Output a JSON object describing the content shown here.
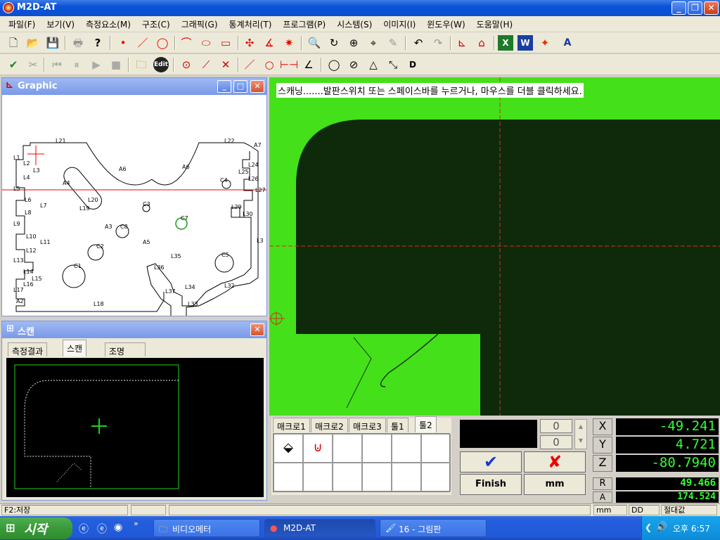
{
  "window": {
    "title": "M2D-AT",
    "min_label": "_",
    "max_label": "❐",
    "close_label": "✕"
  },
  "menu": [
    "파일(F)",
    "보기(V)",
    "측정요소(M)",
    "구조(C)",
    "그래픽(G)",
    "통계처리(T)",
    "프로그램(P)",
    "시스템(S)",
    "이미지(I)",
    "윈도우(W)",
    "도움말(H)"
  ],
  "toolbar": {
    "edit_label": "Edit",
    "dim_label": "D",
    "text_label": "A",
    "excel_label": "X",
    "word_label": "W"
  },
  "graphic_panel": {
    "title": "Graphic",
    "labels": [
      "L21",
      "L22",
      "A7",
      "L1",
      "L2",
      "L3",
      "A6",
      "A6",
      "L24",
      "L25",
      "L26",
      "L4",
      "L5",
      "A4",
      "C4",
      "L27",
      "L6",
      "L7",
      "L20",
      "C3",
      "L29",
      "L8",
      "L19",
      "C7",
      "L30",
      "L9",
      "A3",
      "C8",
      "L10",
      "L11",
      "C2",
      "A5",
      "L3",
      "L12",
      "L35",
      "L13",
      "C1",
      "L36",
      "C5",
      "L14",
      "L15",
      "L16",
      "L17",
      "L37",
      "L34",
      "L32",
      "A2",
      "L18",
      "L33"
    ]
  },
  "scan_panel": {
    "title": "스캔",
    "tabs": [
      "측정결과",
      "스캔",
      "조명"
    ]
  },
  "camera": {
    "instruction": "스캐닝.......발판스위치 또는 스페이스바를 누르거나, 마우스를 더블 클릭하세요."
  },
  "macro_tabs": [
    "매크로1",
    "매크로2",
    "매크로3",
    "툴1",
    "툴2"
  ],
  "counters": {
    "top": "0",
    "bottom": "0"
  },
  "actions": {
    "finish_label": "Finish",
    "unit_label": "mm"
  },
  "readouts": [
    {
      "axis": "X",
      "value": "-49.241"
    },
    {
      "axis": "Y",
      "value": "4.721"
    },
    {
      "axis": "Z",
      "value": "-80.7940"
    },
    {
      "axis": "R",
      "value": "49.466"
    },
    {
      "axis": "A",
      "value": "174.524"
    }
  ],
  "status": {
    "hint": "F2:저장",
    "unit": "mm",
    "angle_format": "DD",
    "coord_mode": "절대값"
  },
  "taskbar": {
    "start_label": "시작",
    "items": [
      "비디오메터",
      "M2D-AT",
      "16 - 그림판"
    ],
    "clock": "오후 6:57"
  },
  "colors": {
    "camera_bg": "#44e01a",
    "part_dark": "#0e2a0b",
    "readout_text": "#33ff33",
    "crosshair": "#d03020"
  }
}
